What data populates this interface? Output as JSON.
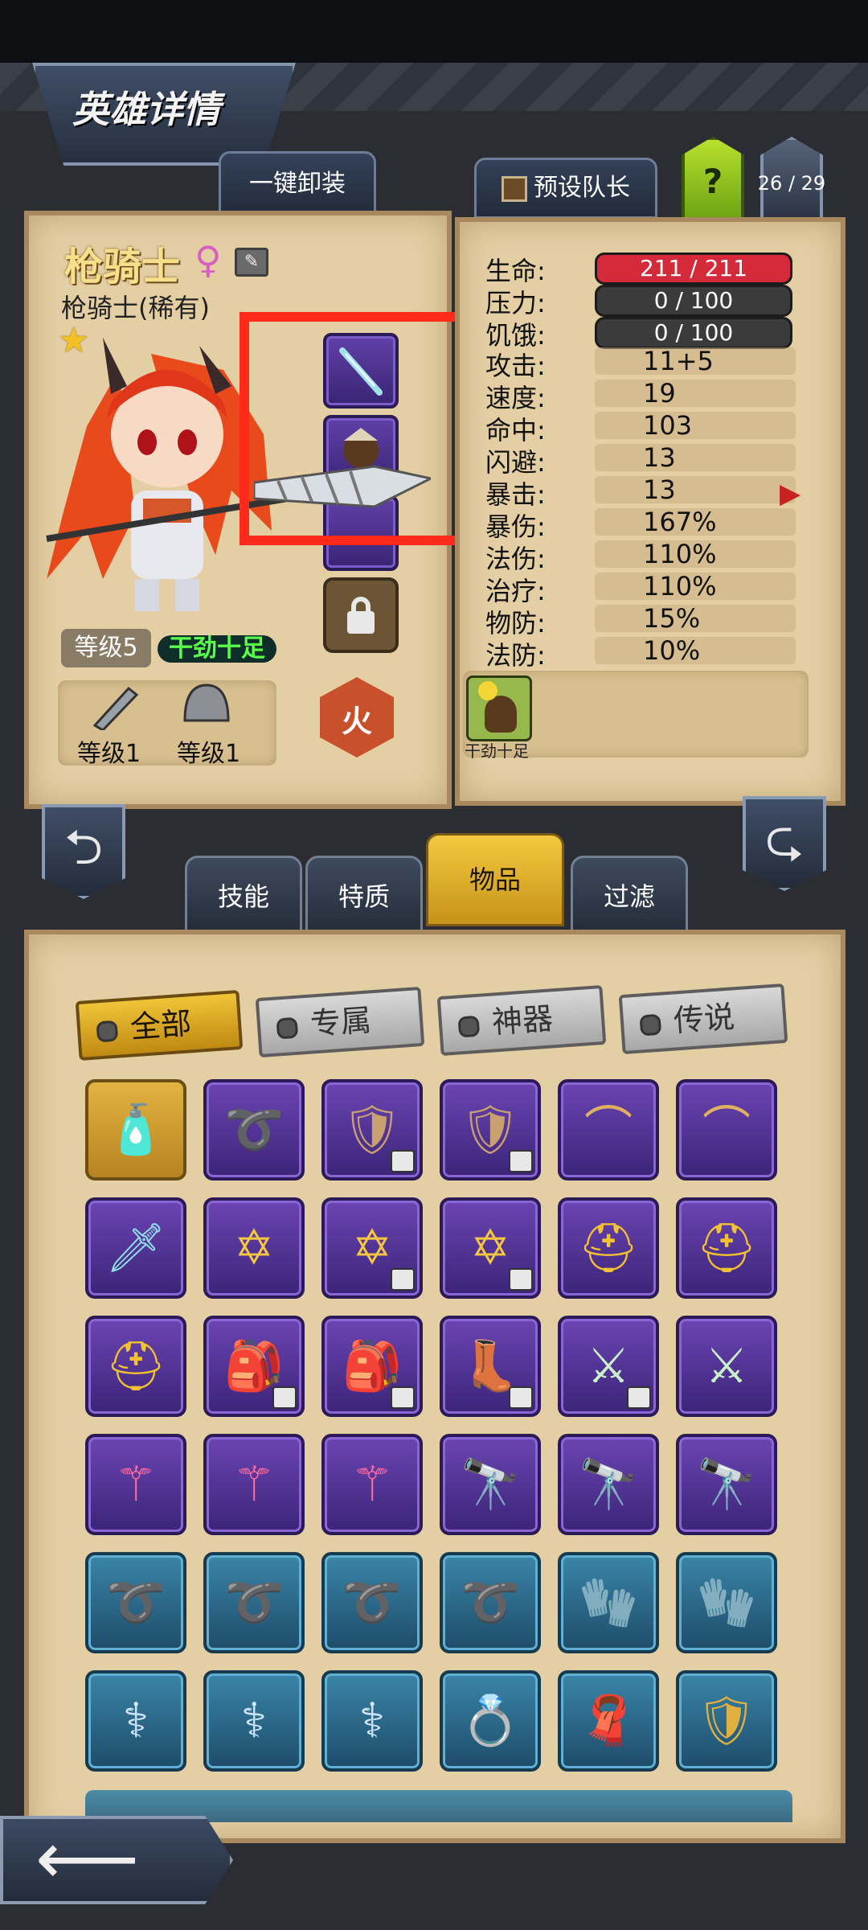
{
  "header": {
    "title": "英雄详情"
  },
  "buttons": {
    "unequip_all": "一键卸装",
    "preset_captain": "预设队长",
    "help": "?",
    "roster_count": "26 / 29"
  },
  "hero": {
    "name": "枪骑士",
    "class": "枪骑士(稀有)",
    "level": "等级5",
    "status": "干劲十足",
    "element": "火",
    "gear_levels": [
      "等级1",
      "等级1"
    ]
  },
  "stats": {
    "bars": [
      {
        "label": "生命:",
        "value": "211 / 211",
        "color": "#d42a3a"
      },
      {
        "label": "压力:",
        "value": "0 / 100",
        "color": "#3b3b3b"
      },
      {
        "label": "饥饿:",
        "value": "0 / 100",
        "color": "#3b3b3b"
      }
    ],
    "rows": [
      {
        "label": "攻击:",
        "value": "11+5"
      },
      {
        "label": "速度:",
        "value": "19"
      },
      {
        "label": "命中:",
        "value": "103"
      },
      {
        "label": "闪避:",
        "value": "13"
      },
      {
        "label": "暴击:",
        "value": "13"
      },
      {
        "label": "暴伤:",
        "value": "167%"
      },
      {
        "label": "法伤:",
        "value": "110%"
      },
      {
        "label": "治疗:",
        "value": "110%"
      },
      {
        "label": "物防:",
        "value": "15%"
      },
      {
        "label": "法防:",
        "value": "10%"
      }
    ],
    "trait_label": "干劲十足"
  },
  "category_tabs": [
    "技能",
    "特质",
    "物品",
    "过滤"
  ],
  "active_category": "物品",
  "filter_chips": [
    "全部",
    "专属",
    "神器",
    "传说"
  ],
  "active_filter": "全部",
  "inventory": [
    [
      {
        "t": "gold",
        "i": "bottle-icon"
      },
      {
        "t": "purple",
        "i": "whip-icon"
      },
      {
        "t": "purple",
        "i": "armor-icon",
        "l": 1
      },
      {
        "t": "purple",
        "i": "armor-icon",
        "l": 1
      },
      {
        "t": "purple",
        "i": "fang-necklace-icon"
      },
      {
        "t": "purple",
        "i": "fang-necklace-icon"
      }
    ],
    [
      {
        "t": "purple",
        "i": "spear-icon"
      },
      {
        "t": "purple",
        "i": "star-amulet-icon"
      },
      {
        "t": "purple",
        "i": "star-amulet-icon",
        "l": 1
      },
      {
        "t": "purple",
        "i": "star-amulet-icon",
        "l": 1
      },
      {
        "t": "purple",
        "i": "helmet-icon"
      },
      {
        "t": "purple",
        "i": "helmet-icon"
      }
    ],
    [
      {
        "t": "purple",
        "i": "helmet-icon"
      },
      {
        "t": "purple",
        "i": "backpack-icon",
        "l": 1
      },
      {
        "t": "purple",
        "i": "backpack-icon",
        "l": 1
      },
      {
        "t": "purple",
        "i": "winged-boots-icon",
        "l": 1
      },
      {
        "t": "purple",
        "i": "sword-icon",
        "l": 1
      },
      {
        "t": "purple",
        "i": "sword-icon"
      }
    ],
    [
      {
        "t": "purple",
        "i": "crystal-staff-icon"
      },
      {
        "t": "purple",
        "i": "crystal-staff-icon"
      },
      {
        "t": "purple",
        "i": "crystal-staff-icon"
      },
      {
        "t": "purple",
        "i": "telescope-icon"
      },
      {
        "t": "purple",
        "i": "telescope-icon"
      },
      {
        "t": "purple",
        "i": "telescope-icon"
      }
    ],
    [
      {
        "t": "blue",
        "i": "whip-icon"
      },
      {
        "t": "blue",
        "i": "whip-icon"
      },
      {
        "t": "blue",
        "i": "whip-icon"
      },
      {
        "t": "blue",
        "i": "whip-icon"
      },
      {
        "t": "blue",
        "i": "claw-glove-icon"
      },
      {
        "t": "blue",
        "i": "claw-glove-icon"
      }
    ],
    [
      {
        "t": "blue",
        "i": "wand-icon"
      },
      {
        "t": "blue",
        "i": "wand-icon"
      },
      {
        "t": "blue",
        "i": "wand-icon"
      },
      {
        "t": "blue",
        "i": "ring-icon"
      },
      {
        "t": "blue",
        "i": "scarf-icon"
      },
      {
        "t": "blue",
        "i": "shield-icon"
      }
    ]
  ]
}
